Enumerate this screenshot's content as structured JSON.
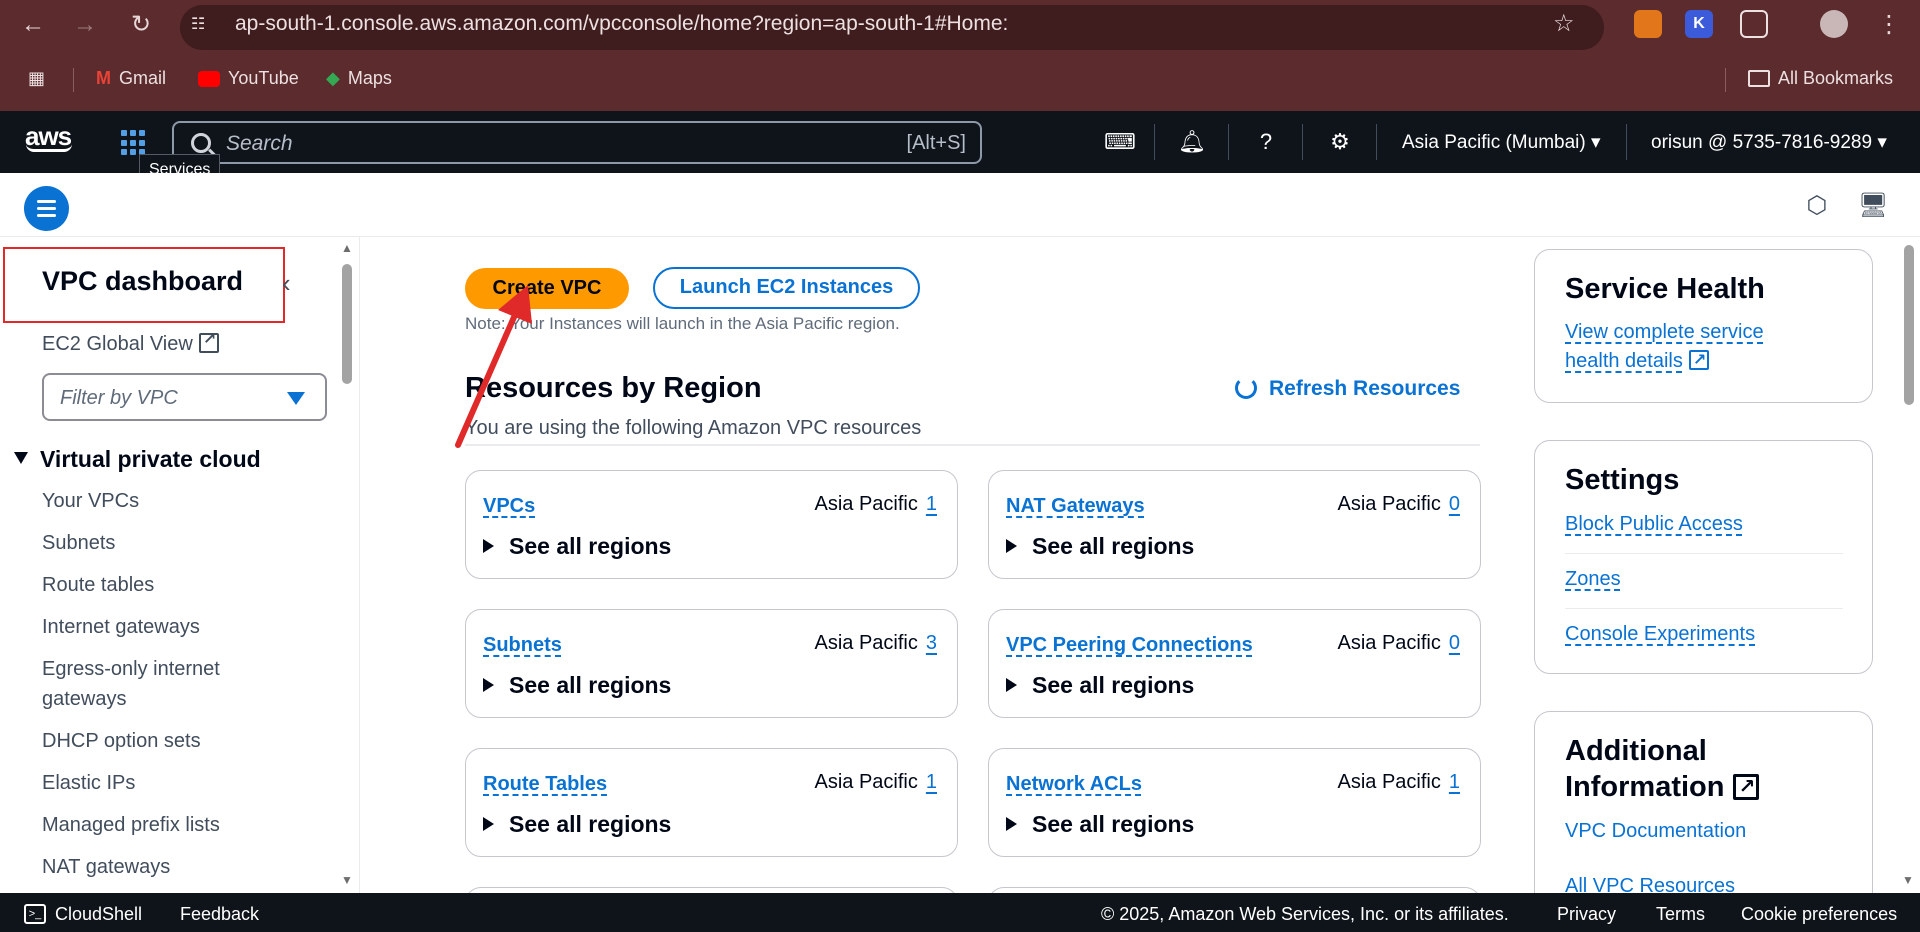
{
  "browser": {
    "url": "ap-south-1.console.aws.amazon.com/vpcconsole/home?region=ap-south-1#Home:",
    "bookmarks": [
      "Gmail",
      "YouTube",
      "Maps"
    ],
    "all_bookmarks": "All Bookmarks"
  },
  "topnav": {
    "search_placeholder": "Search",
    "search_shortcut": "[Alt+S]",
    "services_tooltip": "Services",
    "region": "Asia Pacific (Mumbai)",
    "account": "orisun @ 5735-7816-9289"
  },
  "sidebar": {
    "title": "VPC dashboard",
    "global_view": "EC2 Global View",
    "filter_placeholder": "Filter by VPC",
    "section": "Virtual private cloud",
    "items": [
      "Your VPCs",
      "Subnets",
      "Route tables",
      "Internet gateways",
      "Egress-only internet",
      "gateways",
      "DHCP option sets",
      "Elastic IPs",
      "Managed prefix lists",
      "NAT gateways"
    ]
  },
  "main": {
    "create_vpc": "Create VPC",
    "launch_ec2": "Launch EC2 Instances",
    "note": "Note: Your Instances will launch in the Asia Pacific region.",
    "resources_title": "Resources by Region",
    "resources_sub": "You are using the following Amazon VPC resources",
    "refresh": "Refresh Resources",
    "see_all": "See all regions",
    "region_label": "Asia Pacific",
    "cards": [
      {
        "name": "VPCs",
        "count": "1"
      },
      {
        "name": "NAT Gateways",
        "count": "0"
      },
      {
        "name": "Subnets",
        "count": "3"
      },
      {
        "name": "VPC Peering Connections",
        "count": "0"
      },
      {
        "name": "Route Tables",
        "count": "1"
      },
      {
        "name": "Network ACLs",
        "count": "1"
      }
    ]
  },
  "panels": {
    "service_health": {
      "title": "Service Health",
      "link_line1": "View complete service",
      "link_line2": "health details"
    },
    "settings": {
      "title": "Settings",
      "links": [
        "Block Public Access",
        "Zones",
        "Console Experiments"
      ]
    },
    "additional": {
      "title_line1": "Additional",
      "title_line2": "Information",
      "links": [
        "VPC Documentation",
        "All VPC Resources"
      ]
    }
  },
  "footer": {
    "cloudshell": "CloudShell",
    "feedback": "Feedback",
    "copyright": "© 2025, Amazon Web Services, Inc. or its affiliates.",
    "privacy": "Privacy",
    "terms": "Terms",
    "cookie": "Cookie preferences"
  },
  "colors": {
    "brand_orange": "#ff9900",
    "link_blue": "#0972d3",
    "nav_dark": "#0f141a",
    "chrome_bg": "#5b2b2e",
    "annotation_red": "#e02a2a"
  }
}
